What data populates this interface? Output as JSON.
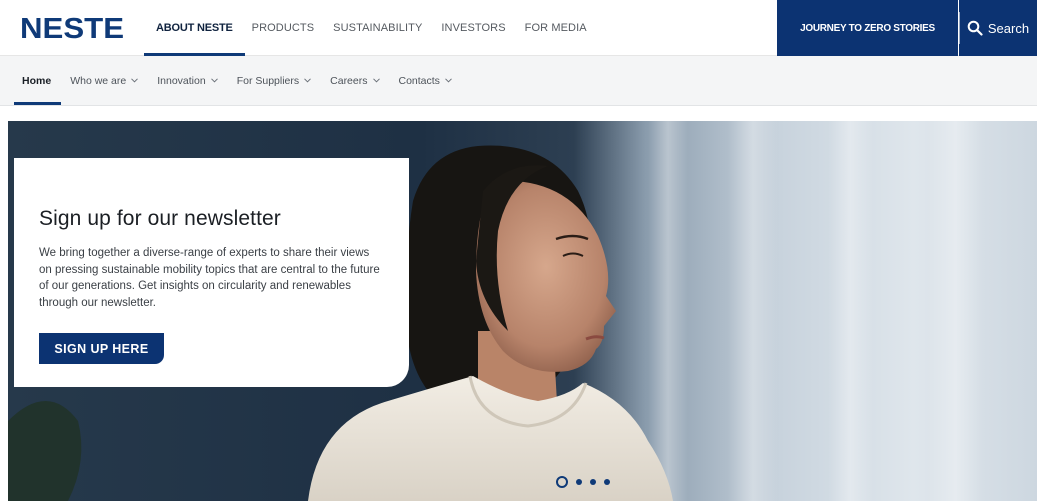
{
  "brand": {
    "logo_text": "NESTE",
    "logo_color": "#0f3a78"
  },
  "main_nav": {
    "items": [
      {
        "label": "ABOUT NESTE",
        "active": true
      },
      {
        "label": "PRODUCTS",
        "active": false
      },
      {
        "label": "SUSTAINABILITY",
        "active": false
      },
      {
        "label": "INVESTORS",
        "active": false
      },
      {
        "label": "FOR MEDIA",
        "active": false
      }
    ],
    "journey_label": "JOURNEY TO ZERO STORIES",
    "search_label": "Search",
    "search_icon": "search-icon"
  },
  "sub_nav": {
    "items": [
      {
        "label": "Home",
        "active": true,
        "dropdown": false
      },
      {
        "label": "Who we are",
        "active": false,
        "dropdown": true
      },
      {
        "label": "Innovation",
        "active": false,
        "dropdown": true
      },
      {
        "label": "For Suppliers",
        "active": false,
        "dropdown": true
      },
      {
        "label": "Careers",
        "active": false,
        "dropdown": true
      },
      {
        "label": "Contacts",
        "active": false,
        "dropdown": true
      }
    ]
  },
  "hero": {
    "card_title": "Sign up for our newsletter",
    "card_text": "We bring together a diverse-range of experts to share their views on pressing sustainable mobility topics that are central to the future of our generations. Get insights on circularity and renewables through our newsletter.",
    "cta_label": "SIGN UP HERE",
    "slide_count": 4,
    "active_slide": 1
  },
  "colors": {
    "primary": "#0c3372",
    "accent": "#0f3a78"
  }
}
